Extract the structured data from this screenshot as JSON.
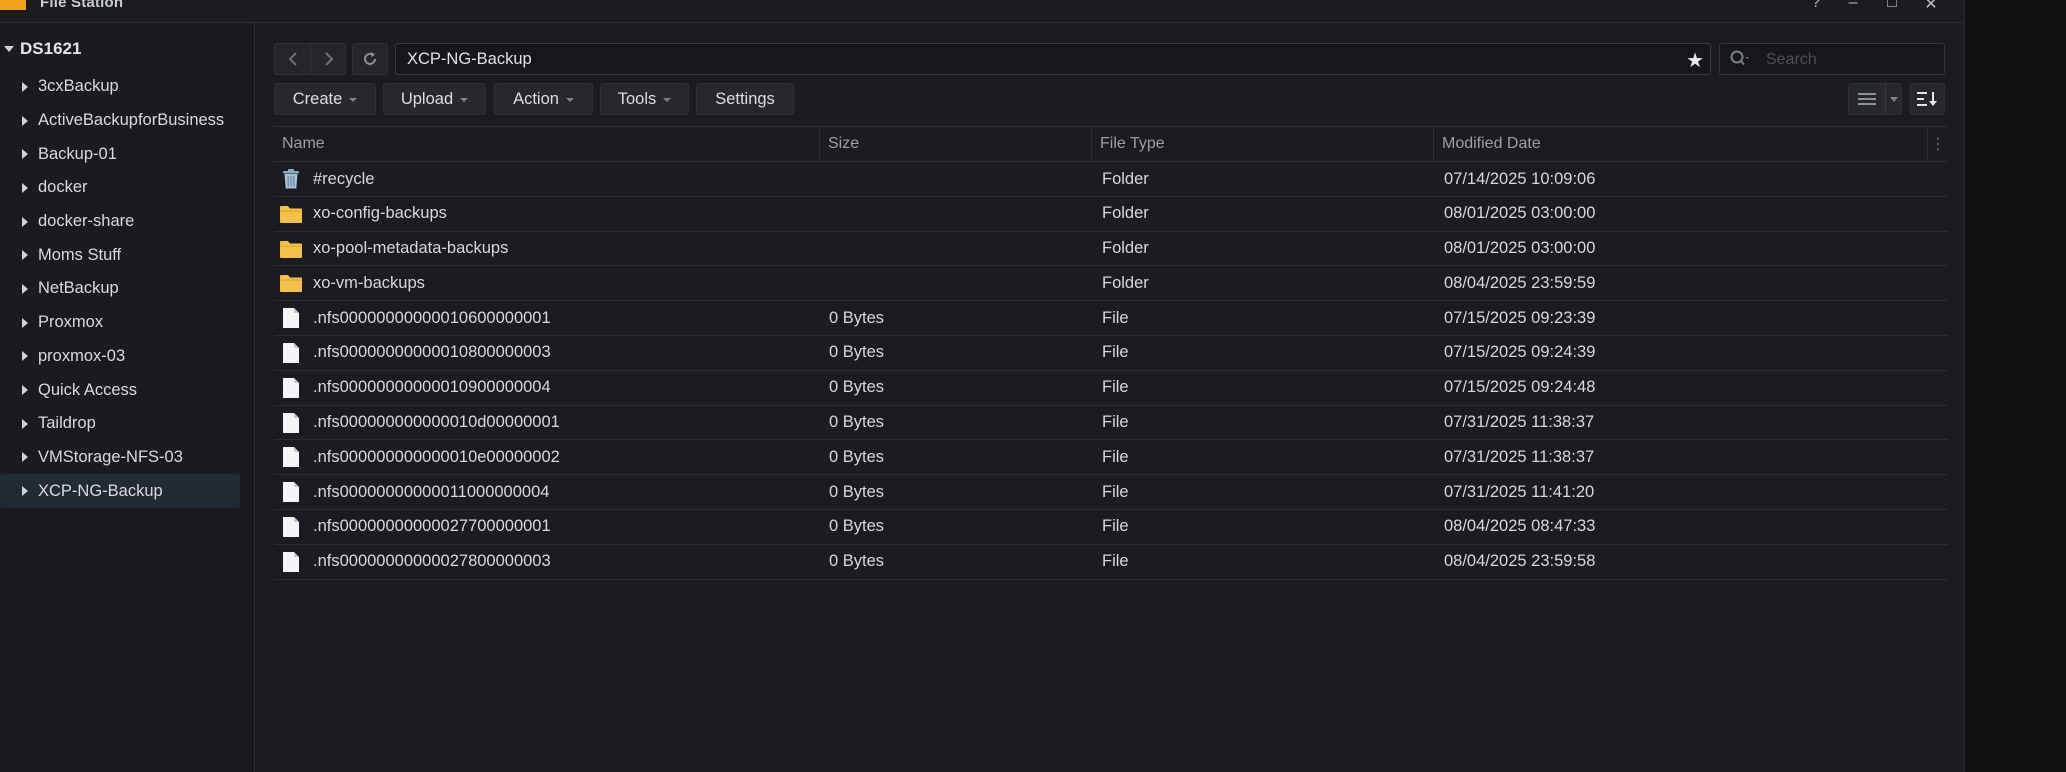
{
  "app": {
    "title": "File Station",
    "window_buttons": {
      "help": "?",
      "minimize": "–",
      "maximize": "□",
      "close": "✕"
    }
  },
  "sidebar": {
    "root": "DS1621",
    "items": [
      {
        "label": "3cxBackup"
      },
      {
        "label": "ActiveBackupforBusiness"
      },
      {
        "label": "Backup-01"
      },
      {
        "label": "docker"
      },
      {
        "label": "docker-share"
      },
      {
        "label": "Moms Stuff"
      },
      {
        "label": "NetBackup"
      },
      {
        "label": "Proxmox"
      },
      {
        "label": "proxmox-03"
      },
      {
        "label": "Quick Access"
      },
      {
        "label": "Taildrop"
      },
      {
        "label": "VMStorage-NFS-03"
      },
      {
        "label": "XCP-NG-Backup",
        "selected": true
      }
    ]
  },
  "toolbar": {
    "path": "XCP-NG-Backup",
    "search_placeholder": "Search",
    "create": "Create",
    "upload": "Upload",
    "action": "Action",
    "tools": "Tools",
    "settings": "Settings"
  },
  "table": {
    "columns": {
      "name": "Name",
      "size": "Size",
      "type": "File Type",
      "date": "Modified Date"
    },
    "rows": [
      {
        "icon": "recycle-bin-icon",
        "name": "#recycle",
        "size": "",
        "type": "Folder",
        "date": "07/14/2025 10:09:06"
      },
      {
        "icon": "folder-icon",
        "name": "xo-config-backups",
        "size": "",
        "type": "Folder",
        "date": "08/01/2025 03:00:00"
      },
      {
        "icon": "folder-icon",
        "name": "xo-pool-metadata-backups",
        "size": "",
        "type": "Folder",
        "date": "08/01/2025 03:00:00"
      },
      {
        "icon": "folder-icon",
        "name": "xo-vm-backups",
        "size": "",
        "type": "Folder",
        "date": "08/04/2025 23:59:59"
      },
      {
        "icon": "file-icon",
        "name": ".nfs00000000000010600000001",
        "size": "0 Bytes",
        "type": "File",
        "date": "07/15/2025 09:23:39"
      },
      {
        "icon": "file-icon",
        "name": ".nfs00000000000010800000003",
        "size": "0 Bytes",
        "type": "File",
        "date": "07/15/2025 09:24:39"
      },
      {
        "icon": "file-icon",
        "name": ".nfs00000000000010900000004",
        "size": "0 Bytes",
        "type": "File",
        "date": "07/15/2025 09:24:48"
      },
      {
        "icon": "file-icon",
        "name": ".nfs000000000000010d00000001",
        "size": "0 Bytes",
        "type": "File",
        "date": "07/31/2025 11:38:37"
      },
      {
        "icon": "file-icon",
        "name": ".nfs000000000000010e00000002",
        "size": "0 Bytes",
        "type": "File",
        "date": "07/31/2025 11:38:37"
      },
      {
        "icon": "file-icon",
        "name": ".nfs00000000000011000000004",
        "size": "0 Bytes",
        "type": "File",
        "date": "07/31/2025 11:41:20"
      },
      {
        "icon": "file-icon",
        "name": ".nfs00000000000027700000001",
        "size": "0 Bytes",
        "type": "File",
        "date": "08/04/2025 08:47:33"
      },
      {
        "icon": "file-icon",
        "name": ".nfs00000000000027800000003",
        "size": "0 Bytes",
        "type": "File",
        "date": "08/04/2025 23:59:58"
      }
    ]
  },
  "colors": {
    "folder": "#f3c14b",
    "accent_selected": "#222a33",
    "background": "#1b1c1f"
  }
}
